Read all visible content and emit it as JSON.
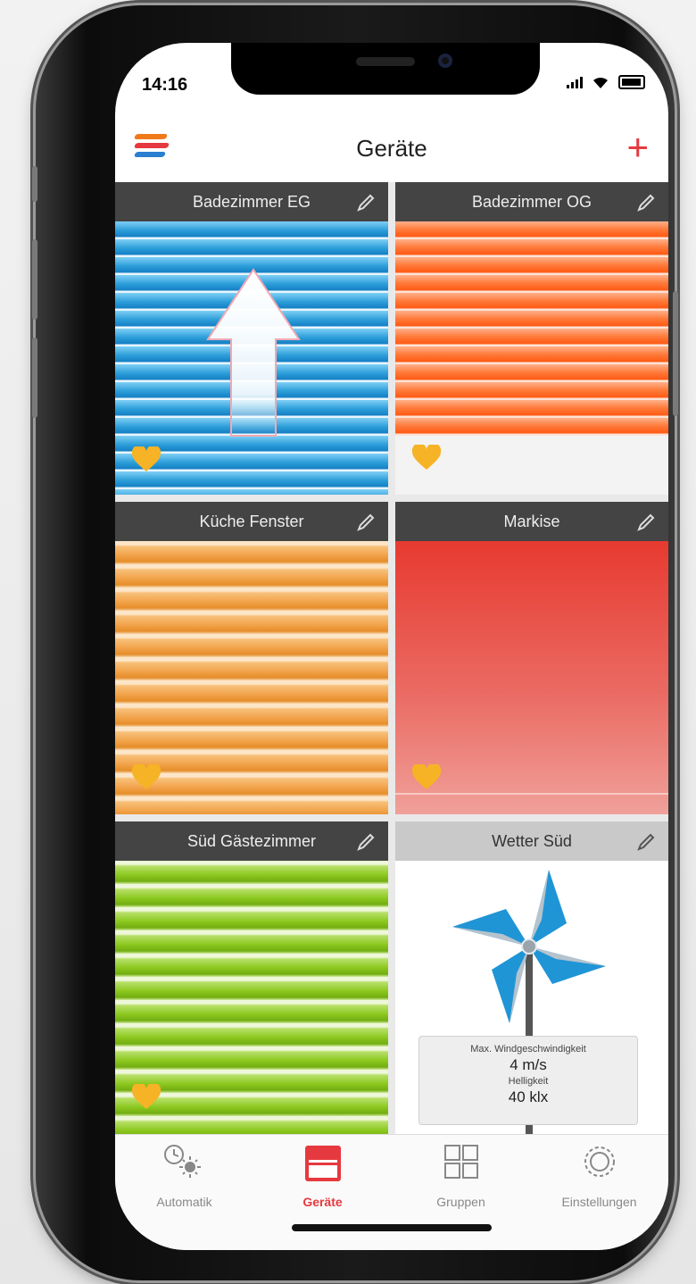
{
  "status": {
    "time": "14:16"
  },
  "header": {
    "title": "Geräte",
    "menu_icon": "hamburger-stripes-icon",
    "add_icon": "plus-icon"
  },
  "devices": [
    {
      "name": "Badezimmer EG",
      "type": "blind",
      "color": "#2a9ad8",
      "favorite": true
    },
    {
      "name": "Badezimmer OG",
      "type": "blind",
      "color": "#ff6a28",
      "favorite": true
    },
    {
      "name": "Küche Fenster",
      "type": "shutter",
      "color": "#f2a24a",
      "favorite": true
    },
    {
      "name": "Markise",
      "type": "awning",
      "color": "#e84137",
      "favorite": true
    },
    {
      "name": "Süd Gästezimmer",
      "type": "shutter",
      "color": "#8cc81e",
      "favorite": true
    },
    {
      "name": "Wetter Süd",
      "type": "weather",
      "favorite": false,
      "wind_label": "Max. Windgeschwindigkeit",
      "wind_value": "4 m/s",
      "brightness_label": "Helligkeit",
      "brightness_value": "40 klx"
    }
  ],
  "tabs": [
    {
      "label": "Automatik",
      "icon": "clock-sun-icon",
      "active": false
    },
    {
      "label": "Geräte",
      "icon": "device-icon",
      "active": true
    },
    {
      "label": "Gruppen",
      "icon": "grid-icon",
      "active": false
    },
    {
      "label": "Einstellungen",
      "icon": "gear-icon",
      "active": false
    }
  ],
  "colors": {
    "accent": "#e6393f"
  }
}
